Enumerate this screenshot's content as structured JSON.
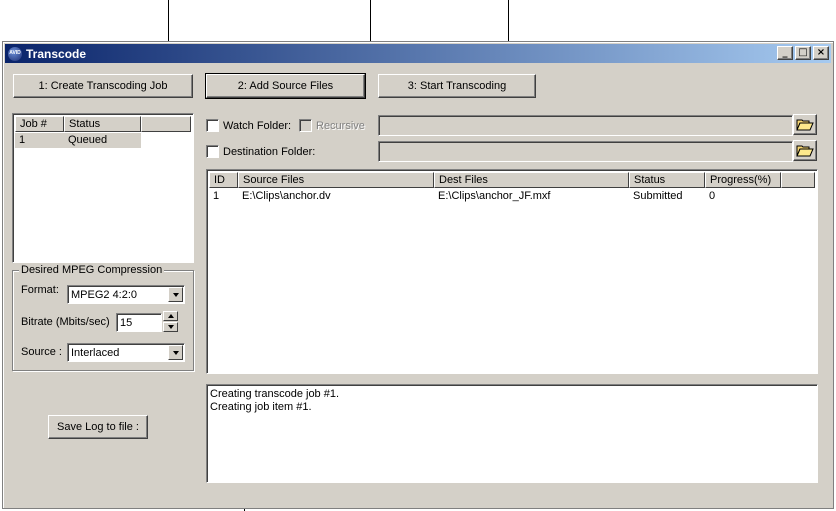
{
  "window": {
    "title": "Transcode",
    "icon_text": "AVID",
    "controls": {
      "minimize": "_",
      "maximize": "□",
      "close": "×"
    }
  },
  "buttons": {
    "create_job": "1: Create Transcoding Job",
    "add_source": "2: Add Source Files",
    "start_transcoding": "3: Start Transcoding",
    "save_log": "Save Log to file :"
  },
  "jobs_list": {
    "columns": [
      "Job #",
      "Status"
    ],
    "rows": [
      {
        "job": "1",
        "status": "Queued",
        "selected": true
      }
    ]
  },
  "compression": {
    "group_label": "Desired MPEG Compression",
    "format_label": "Format:",
    "format_value": "MPEG2 4:2:0",
    "bitrate_label": "Bitrate (Mbits/sec)",
    "bitrate_value": "15",
    "source_label": "Source :",
    "source_value": "Interlaced"
  },
  "folders": {
    "watch_label": "Watch Folder:",
    "watch_checked": false,
    "recursive_label": "Recursive",
    "recursive_enabled": false,
    "watch_path": "",
    "dest_label": "Destination Folder:",
    "dest_checked": false,
    "dest_path": ""
  },
  "files_list": {
    "columns": [
      "ID",
      "Source Files",
      "Dest Files",
      "Status",
      "Progress(%)"
    ],
    "rows": [
      {
        "id": "1",
        "source": "E:\\Clips\\anchor.dv",
        "dest": "E:\\Clips\\anchor_JF.mxf",
        "status": "Submitted",
        "progress": "0"
      }
    ]
  },
  "log": {
    "lines": [
      "Creating transcode job #1.",
      "Creating job item #1."
    ]
  },
  "icons": {
    "folder_open": "folder-open-icon",
    "app": "avid-icon"
  },
  "colors": {
    "titlebar_start": "#0a246a",
    "titlebar_end": "#a6caf0",
    "face": "#d4d0c8",
    "selection": "#d4d0c8"
  }
}
